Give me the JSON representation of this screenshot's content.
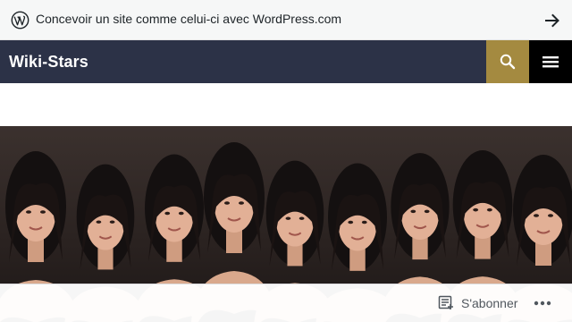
{
  "promo": {
    "text": "Concevoir un site comme celui-ci avec WordPress.com"
  },
  "header": {
    "site_title": "Wiki-Stars"
  },
  "actionbar": {
    "subscribe_label": "S'abonner"
  },
  "colors": {
    "header_bg": "#2c3247",
    "search_bg": "#a48a40",
    "menu_bg": "#000000"
  },
  "icons": [
    "wordpress-logo-icon",
    "arrow-right-icon",
    "search-icon",
    "hamburger-menu-icon",
    "reader-icon",
    "more-dots-icon"
  ]
}
